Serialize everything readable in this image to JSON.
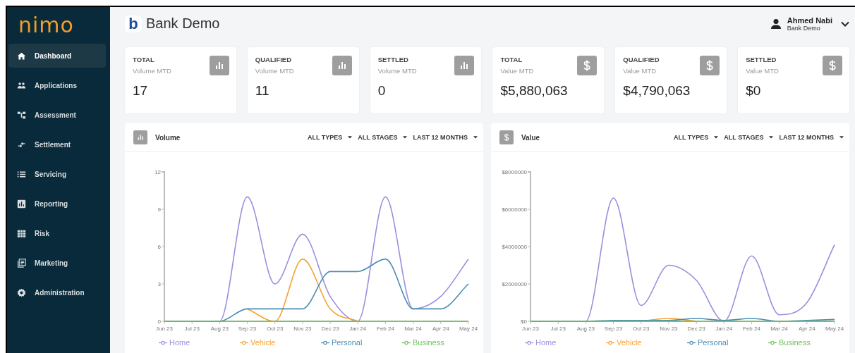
{
  "sidebar": {
    "logo": "nimo",
    "items": [
      {
        "label": "Dashboard",
        "selected": true
      },
      {
        "label": "Applications",
        "selected": false
      },
      {
        "label": "Assessment",
        "selected": false
      },
      {
        "label": "Settlement",
        "selected": false
      },
      {
        "label": "Servicing",
        "selected": false
      },
      {
        "label": "Reporting",
        "selected": false
      },
      {
        "label": "Risk",
        "selected": false
      },
      {
        "label": "Marketing",
        "selected": false
      },
      {
        "label": "Administration",
        "selected": false
      }
    ]
  },
  "header": {
    "logo_letter": "b",
    "title": "Bank Demo",
    "user": {
      "name": "Ahmed Nabi",
      "org": "Bank Demo"
    }
  },
  "stats": [
    {
      "kind": "volume",
      "label": "TOTAL",
      "sublabel": "Volume MTD",
      "value": "17"
    },
    {
      "kind": "volume",
      "label": "QUALIFIED",
      "sublabel": "Volume MTD",
      "value": "11"
    },
    {
      "kind": "volume",
      "label": "SETTLED",
      "sublabel": "Volume MTD",
      "value": "0"
    },
    {
      "kind": "value",
      "label": "TOTAL",
      "sublabel": "Value MTD",
      "value": "$5,880,063"
    },
    {
      "kind": "value",
      "label": "QUALIFIED",
      "sublabel": "Value MTD",
      "value": "$4,790,063"
    },
    {
      "kind": "value",
      "label": "SETTLED",
      "sublabel": "Value MTD",
      "value": "$0"
    }
  ],
  "charts": [
    {
      "kind": "volume",
      "title": "Volume",
      "filters": [
        "ALL TYPES",
        "ALL STAGES",
        "LAST 12 MONTHS"
      ],
      "chart_data": {
        "type": "line",
        "categories": [
          "Jun 23",
          "Jul 23",
          "Aug 23",
          "Sep 23",
          "Oct 23",
          "Nov 23",
          "Dec 23",
          "Jan 24",
          "Feb 24",
          "Mar 24",
          "Apr 24",
          "May 24"
        ],
        "ylim": [
          0,
          12
        ],
        "yticks": [
          0,
          3,
          6,
          9,
          12
        ],
        "series": [
          {
            "name": "Home",
            "color": "#9a8fdd",
            "values": [
              0,
              0,
              0,
              10,
              3,
              7,
              2,
              0,
              10,
              1,
              2,
              5
            ]
          },
          {
            "name": "Vehicle",
            "color": "#f5a032",
            "values": [
              null,
              null,
              null,
              1,
              0,
              5,
              1,
              0,
              null,
              null,
              null,
              null
            ]
          },
          {
            "name": "Personal",
            "color": "#4b8db5",
            "values": [
              0,
              0,
              0,
              1,
              1,
              1,
              4,
              4,
              5,
              1,
              1,
              3
            ]
          },
          {
            "name": "Business",
            "color": "#6cc05a",
            "values": [
              0,
              0,
              0,
              0,
              0,
              0,
              0,
              0,
              0,
              0,
              0,
              0
            ]
          }
        ]
      }
    },
    {
      "kind": "value",
      "title": "Value",
      "filters": [
        "ALL TYPES",
        "ALL STAGES",
        "LAST 12 MONTHS"
      ],
      "chart_data": {
        "type": "line",
        "categories": [
          "Jun 23",
          "Jul 23",
          "Aug 23",
          "Sep 23",
          "Oct 23",
          "Nov 23",
          "Dec 23",
          "Jan 24",
          "Feb 24",
          "Mar 24",
          "Apr 24",
          "May 24"
        ],
        "ylim": [
          0,
          8000000
        ],
        "yticks": [
          {
            "value": 0,
            "label": "$0"
          },
          {
            "value": 2000000,
            "label": "$2000000"
          },
          {
            "value": 4000000,
            "label": "$4000000"
          },
          {
            "value": 6000000,
            "label": "$6000000"
          },
          {
            "value": 8000000,
            "label": "$8000000"
          }
        ],
        "series": [
          {
            "name": "Home",
            "color": "#9a8fdd",
            "values": [
              0,
              0,
              0,
              6600000,
              850000,
              3000000,
              2200000,
              0,
              3500000,
              350000,
              1000000,
              4100000
            ]
          },
          {
            "name": "Vehicle",
            "color": "#f5a032",
            "values": [
              null,
              null,
              null,
              null,
              0,
              150000,
              0,
              null,
              null,
              null,
              null,
              null
            ]
          },
          {
            "name": "Personal",
            "color": "#4b8db5",
            "values": [
              0,
              0,
              0,
              50000,
              50000,
              50000,
              150000,
              50000,
              150000,
              0,
              50000,
              100000
            ]
          },
          {
            "name": "Business",
            "color": "#6cc05a",
            "values": [
              0,
              0,
              0,
              0,
              0,
              0,
              0,
              0,
              0,
              0,
              0,
              0
            ]
          }
        ]
      }
    }
  ]
}
